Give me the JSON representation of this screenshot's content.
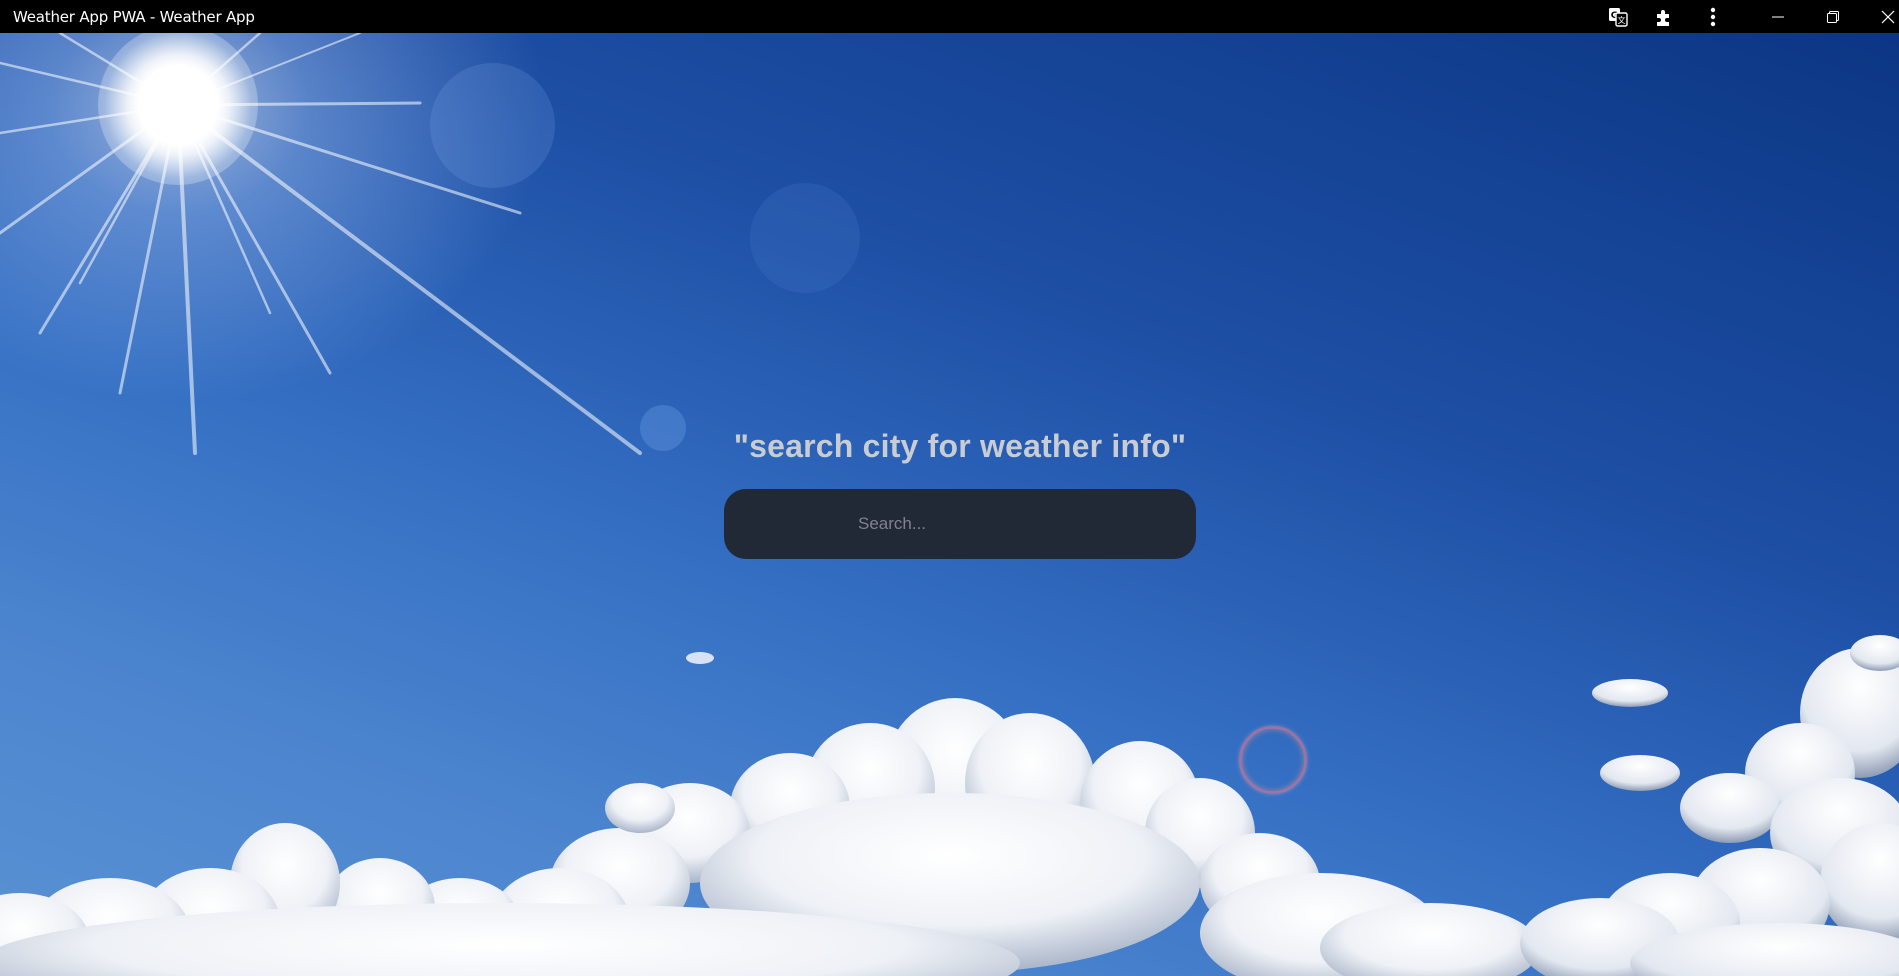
{
  "window": {
    "title": "Weather App PWA - Weather App"
  },
  "titlebar_icons": [
    {
      "name": "translate-icon"
    },
    {
      "name": "extensions-icon"
    },
    {
      "name": "more-menu-icon"
    },
    {
      "name": "minimize-icon"
    },
    {
      "name": "restore-icon"
    },
    {
      "name": "close-icon"
    }
  ],
  "main": {
    "heading": "\"search city for weather info\"",
    "search": {
      "placeholder": "Search...",
      "value": ""
    }
  },
  "colors": {
    "titlebar_bg": "#000000",
    "search_bg": "#212936",
    "heading_text": "#c9ccd2",
    "sky_top": "#0c3684",
    "sky_bottom": "#5b92d4"
  }
}
